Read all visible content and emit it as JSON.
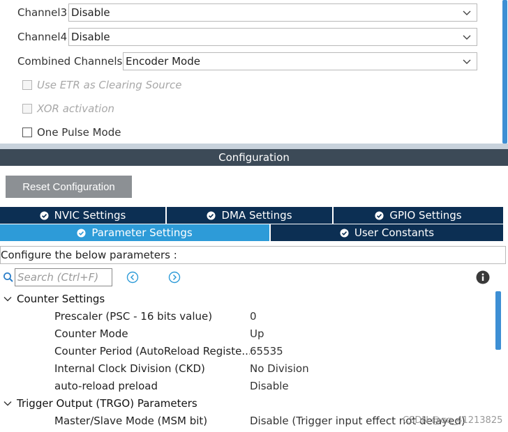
{
  "mode": {
    "channel3": {
      "label": "Channel3",
      "value": "Disable"
    },
    "channel4": {
      "label": "Channel4",
      "value": "Disable"
    },
    "combined": {
      "label": "Combined Channels",
      "value": "Encoder Mode"
    },
    "etr": {
      "label": "Use ETR as Clearing Source",
      "checked": false,
      "enabled": false
    },
    "xor": {
      "label": "XOR activation",
      "checked": false,
      "enabled": false
    },
    "one_pulse": {
      "label": "One Pulse Mode",
      "checked": false,
      "enabled": true
    }
  },
  "configuration": {
    "header": "Configuration",
    "reset_label": "Reset Configuration"
  },
  "tabs": {
    "nvic": "NVIC Settings",
    "dma": "DMA Settings",
    "gpio": "GPIO Settings",
    "parameter": "Parameter Settings",
    "user_constants": "User Constants",
    "active": "parameter"
  },
  "params": {
    "hint": "Configure the below parameters :",
    "search_placeholder": "Search (Ctrl+F)",
    "groups": [
      {
        "name": "Counter Settings",
        "rows": [
          {
            "name": "Prescaler (PSC - 16 bits value)",
            "value": "0"
          },
          {
            "name": "Counter Mode",
            "value": "Up"
          },
          {
            "name": "Counter Period (AutoReload Registe...",
            "value": "65535"
          },
          {
            "name": "Internal Clock Division (CKD)",
            "value": "No Division"
          },
          {
            "name": "auto-reload preload",
            "value": "Disable"
          }
        ]
      },
      {
        "name": "Trigger Output (TRGO) Parameters",
        "rows": [
          {
            "name": "Master/Slave Mode (MSM bit)",
            "value": "Disable (Trigger input effect not delayed)"
          }
        ]
      }
    ]
  },
  "watermark": "CSDN @qq_41213825",
  "colors": {
    "accent": "#2d9bd8",
    "tab_dark": "#0c2f53",
    "header": "#3c4a57",
    "button": "#8c9094",
    "scroll": "#3d8fd4"
  },
  "icons": [
    "chevron-down-icon",
    "check-circle-icon",
    "search-icon",
    "chevron-left-circle-icon",
    "chevron-right-circle-icon",
    "info-icon",
    "caret-down-icon"
  ]
}
